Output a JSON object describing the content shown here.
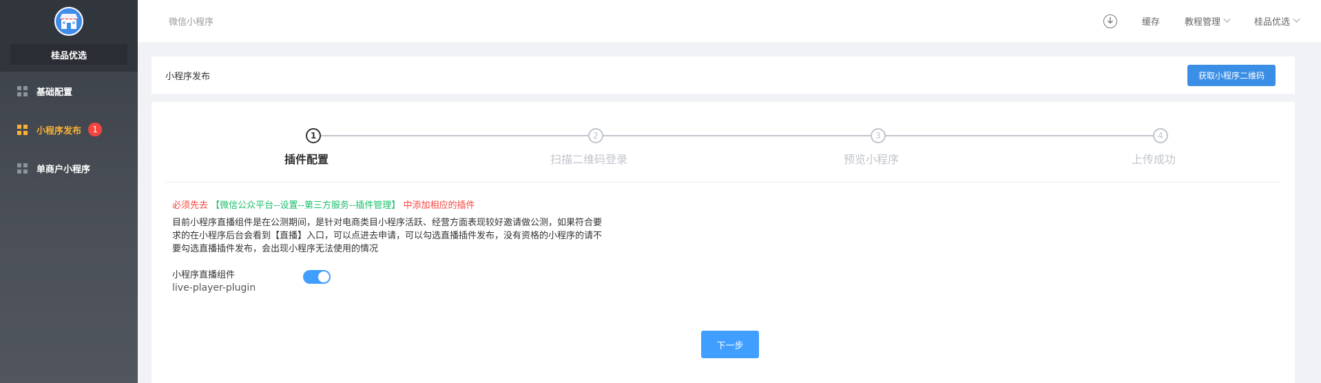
{
  "sidebar": {
    "shop_name": "桂品优选",
    "items": [
      {
        "label": "基础配置",
        "active": false
      },
      {
        "label": "小程序发布",
        "active": true,
        "badge": "1"
      },
      {
        "label": "单商户小程序",
        "active": false
      }
    ]
  },
  "header": {
    "title": "微信小程序",
    "download_icon": "download-icon",
    "cache": "缓存",
    "tutorial": "教程管理",
    "user": "桂品优选"
  },
  "title_panel": {
    "title": "小程序发布",
    "qr_button": "获取小程序二维码"
  },
  "steps": [
    {
      "number": "1",
      "label": "插件配置",
      "active": true
    },
    {
      "number": "2",
      "label": "扫描二维码登录",
      "active": false
    },
    {
      "number": "3",
      "label": "预览小程序",
      "active": false
    },
    {
      "number": "4",
      "label": "上传成功",
      "active": false
    }
  ],
  "notice": {
    "prefix": "必须先去",
    "link": "【微信公众平台--设置--第三方服务--插件管理】",
    "suffix": "中添加相应的插件"
  },
  "description": "目前小程序直播组件是在公测期间，是针对电商类目小程序活跃、经营方面表现较好邀请做公测，如果符合要求的在小程序后台会看到【直播】入口，可以点进去申请，可以勾选直播插件发布，没有资格的小程序的请不要勾选直播插件发布，会出现小程序无法使用的情况",
  "plugin": {
    "name": "小程序直播组件",
    "id": "live-player-plugin",
    "enabled": true
  },
  "next_button": "下一步",
  "colors": {
    "primary": "#409eff",
    "active_menu": "#f8b133",
    "warning_red": "#f5443f",
    "link_green": "#19be6b"
  }
}
